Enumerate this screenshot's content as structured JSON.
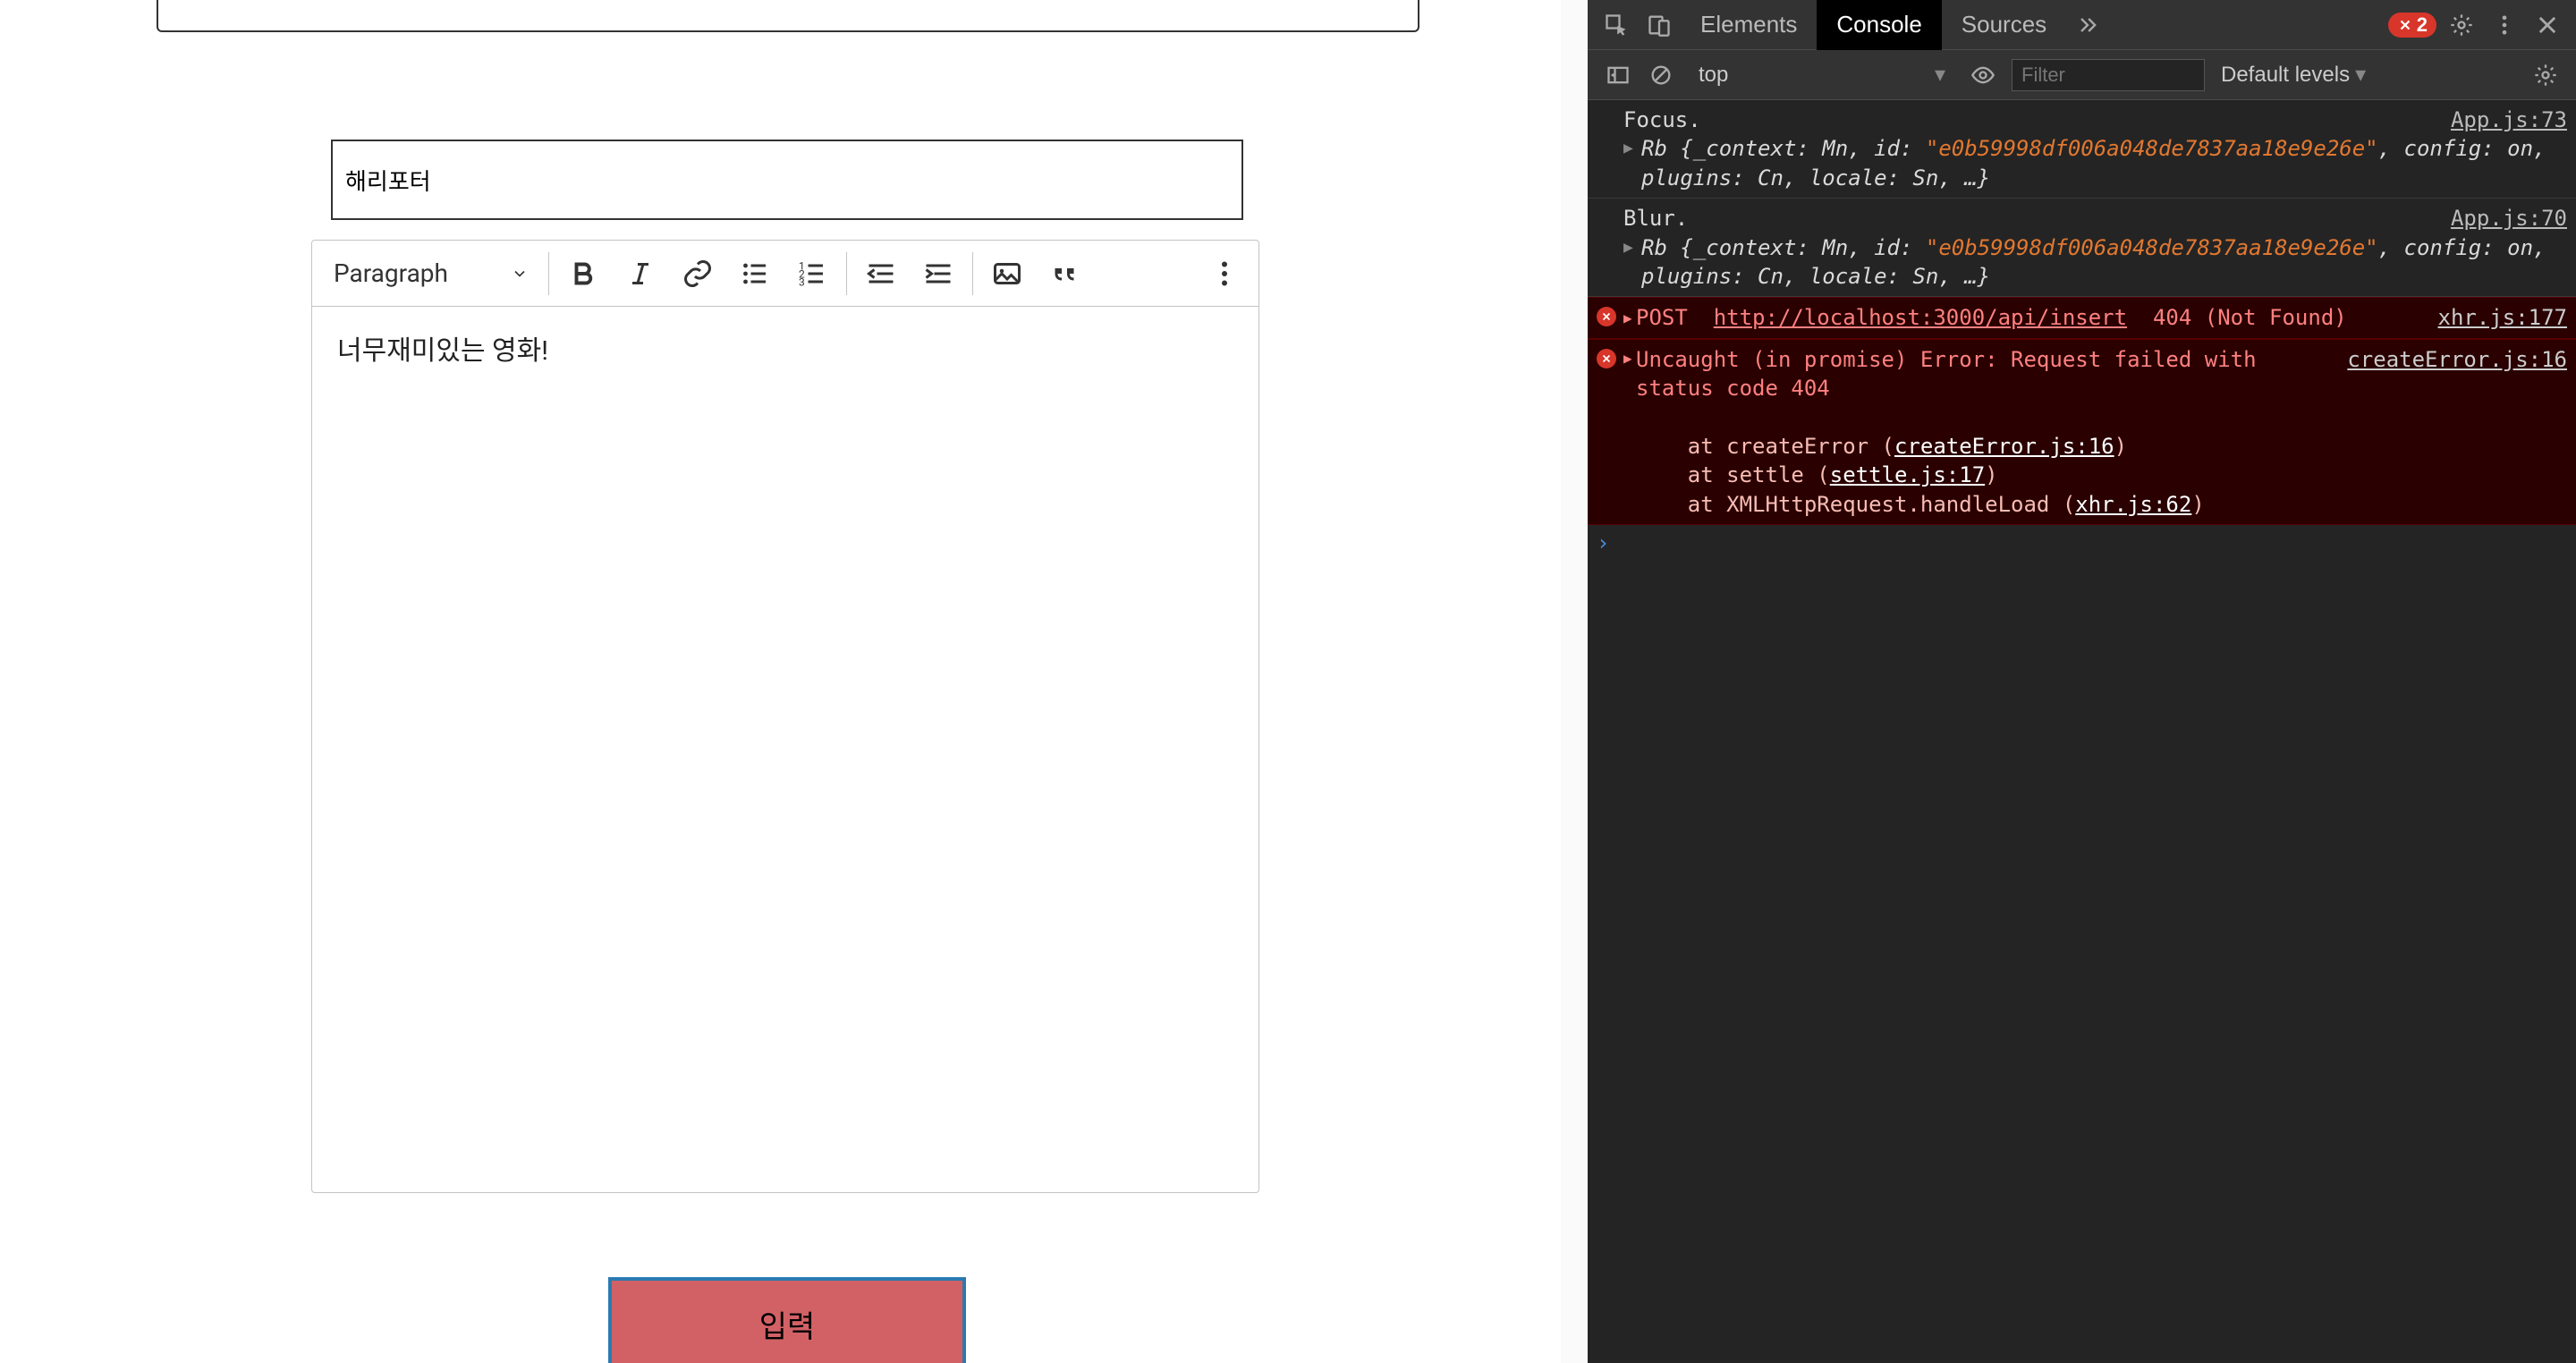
{
  "form": {
    "title_value": "해리포터",
    "editor_paragraph": "너무재미있는 영화!",
    "heading_select": "Paragraph",
    "submit_label": "입력"
  },
  "devtools": {
    "tabs": [
      "Elements",
      "Console",
      "Sources"
    ],
    "active_tab": "Console",
    "error_count": "2",
    "context": "top",
    "filter_placeholder": "Filter",
    "levels_label": "Default levels",
    "log1": {
      "msg": "Focus.",
      "src": "App.js:73",
      "obj_pre": "Rb {_context: Mn, id: ",
      "obj_str": "\"e0b59998df006a048de7837aa18e9e26e\"",
      "obj_post": ", config: on, plugins: Cn, locale: Sn, …}"
    },
    "log2": {
      "msg": "Blur.",
      "src": "App.js:70",
      "obj_pre": "Rb {_context: Mn, id: ",
      "obj_str": "\"e0b59998df006a048de7837aa18e9e26e\"",
      "obj_post": ", config: on, plugins: Cn, locale: Sn, …}"
    },
    "err1": {
      "method": "POST",
      "url": "http://localhost:3000/api/insert",
      "status": "404 (Not Found)",
      "src": "xhr.js:177"
    },
    "err2": {
      "head": "Uncaught (in promise) Error: Request failed with status code 404",
      "src": "createError.js:16",
      "l1a": "    at createError (",
      "l1b": "createError.js:16",
      "l1c": ")",
      "l2a": "    at settle (",
      "l2b": "settle.js:17",
      "l2c": ")",
      "l3a": "    at XMLHttpRequest.handleLoad (",
      "l3b": "xhr.js:62",
      "l3c": ")"
    }
  }
}
